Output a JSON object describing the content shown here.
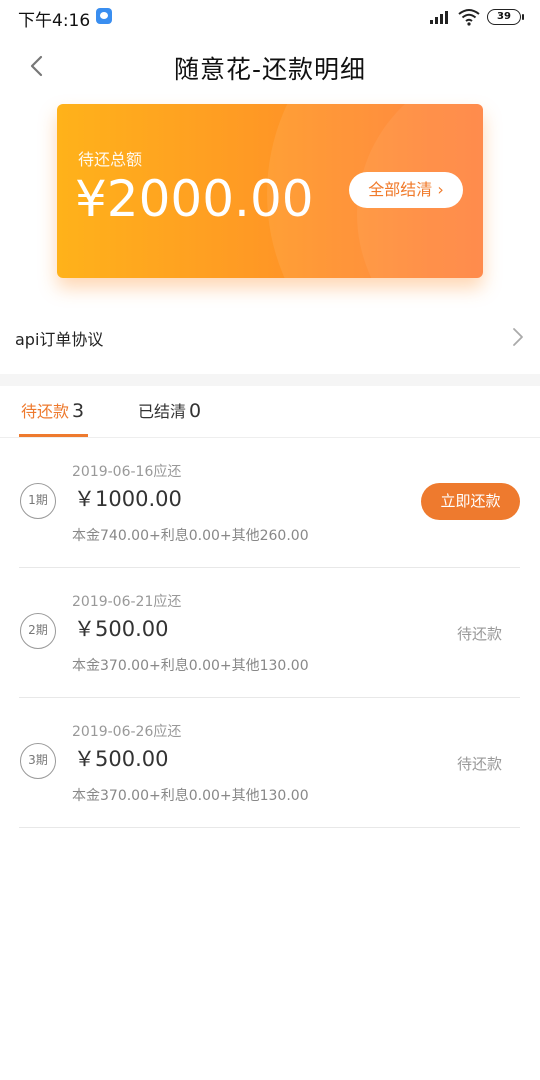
{
  "status_bar": {
    "time": "下午4:16",
    "battery": "39"
  },
  "header": {
    "title": "随意花-还款明细"
  },
  "summary_card": {
    "label": "待还总额",
    "amount": "¥2000.00",
    "settle_all_label": "全部结清",
    "settle_all_chevron": "›"
  },
  "agreement": {
    "label": "api订单协议"
  },
  "tabs": [
    {
      "label": "待还款",
      "count": "3",
      "active": true
    },
    {
      "label": "已结清",
      "count": "0",
      "active": false
    }
  ],
  "installments": [
    {
      "period": "1期",
      "due_date": "2019-06-16应还",
      "amount": "￥1000.00",
      "breakdown": "本金740.00+利息0.00+其他260.00",
      "action_label": "立即还款"
    },
    {
      "period": "2期",
      "due_date": "2019-06-21应还",
      "amount": "￥500.00",
      "breakdown": "本金370.00+利息0.00+其他130.00",
      "status": "待还款"
    },
    {
      "period": "3期",
      "due_date": "2019-06-26应还",
      "amount": "￥500.00",
      "breakdown": "本金370.00+利息0.00+其他130.00",
      "status": "待还款"
    }
  ],
  "colors": {
    "accent": "#ee7a2e",
    "card_gradient_start": "#ffb21a",
    "card_gradient_end": "#ff7a32"
  }
}
